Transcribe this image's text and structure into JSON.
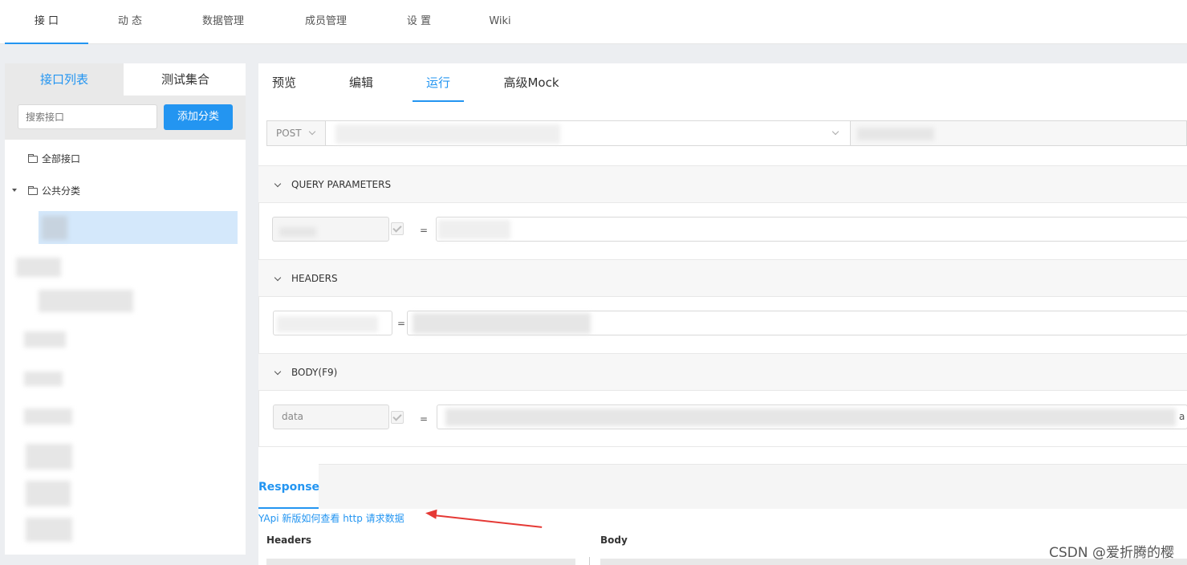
{
  "top_nav": {
    "tabs": [
      "接 口",
      "动 态",
      "数据管理",
      "成员管理",
      "设 置",
      "Wiki"
    ],
    "active_index": 0
  },
  "sidebar": {
    "tabs": [
      "接口列表",
      "测试集合"
    ],
    "search_placeholder": "搜索接口",
    "add_button": "添加分类",
    "tree": {
      "all": "全部接口",
      "public": "公共分类"
    }
  },
  "main": {
    "tabs": [
      "预览",
      "编辑",
      "运行",
      "高级Mock"
    ],
    "active_tab_index": 2,
    "request": {
      "method": "POST"
    },
    "sections": {
      "query": "QUERY PARAMETERS",
      "headers": "HEADERS",
      "body": "BODY(F9)"
    },
    "body_key": "data",
    "body_value_tail": "a",
    "eq": "="
  },
  "response": {
    "tab": "Response",
    "note": "YApi 新版如何查看 http 请求数据",
    "headers_label": "Headers",
    "body_label": "Body"
  },
  "watermark": "CSDN @爱折腾的樱",
  "colors": {
    "accent": "#2395f1",
    "arrow": "#e53935"
  }
}
